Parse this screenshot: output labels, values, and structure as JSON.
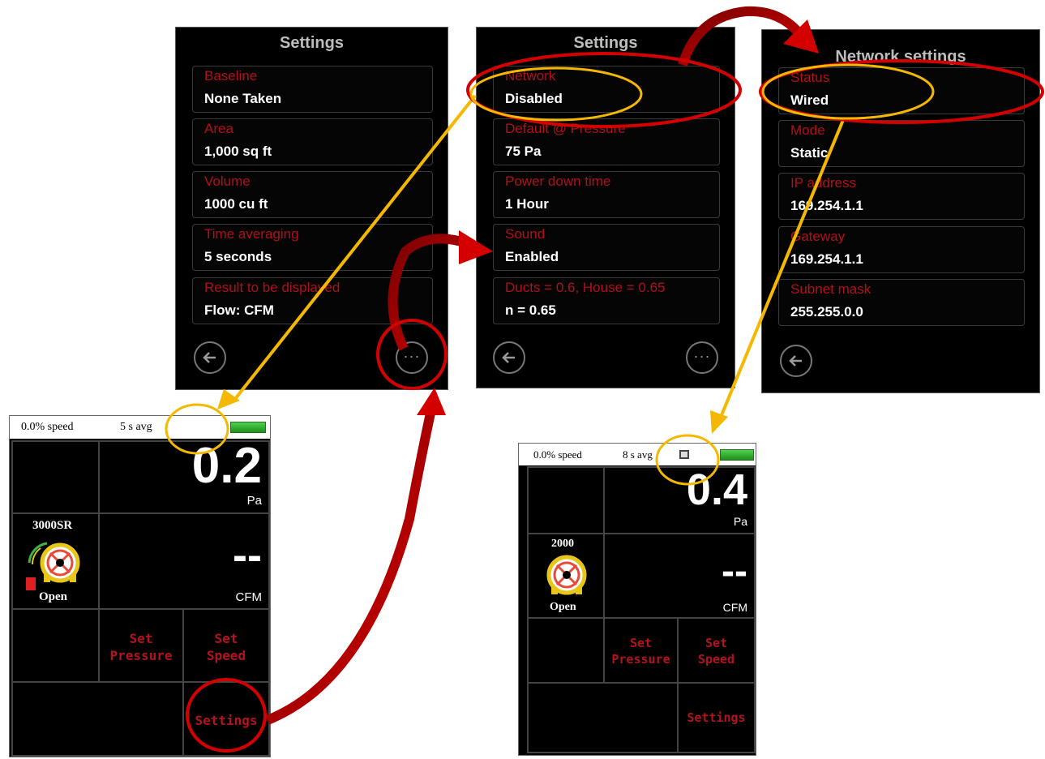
{
  "screen1": {
    "title": "Settings",
    "rows": [
      {
        "label": "Baseline",
        "value": "None Taken"
      },
      {
        "label": "Area",
        "value": "1,000 sq ft"
      },
      {
        "label": "Volume",
        "value": "1000 cu ft"
      },
      {
        "label": "Time averaging",
        "value": "5 seconds"
      },
      {
        "label": "Result to be displayed",
        "value": "Flow: CFM"
      }
    ],
    "back_icon": "left-arrow-icon",
    "more_icon": "more-dots-icon"
  },
  "screen2": {
    "title": "Settings",
    "rows": [
      {
        "label": "Network",
        "value": "Disabled"
      },
      {
        "label": "Default @ Pressure",
        "value": "75 Pa"
      },
      {
        "label": "Power down time",
        "value": "1 Hour"
      },
      {
        "label": "Sound",
        "value": "Enabled"
      },
      {
        "label": "Ducts = 0.6, House = 0.65",
        "value": "n = 0.65"
      }
    ],
    "back_icon": "left-arrow-icon",
    "more_icon": "more-dots-icon"
  },
  "screen3": {
    "title": "Network settings",
    "rows": [
      {
        "label": "Status",
        "value": "Wired"
      },
      {
        "label": "Mode",
        "value": "Static"
      },
      {
        "label": "IP address",
        "value": "169.254.1.1"
      },
      {
        "label": "Gateway",
        "value": "169.254.1.1"
      },
      {
        "label": "Subnet mask",
        "value": "255.255.0.0"
      }
    ],
    "back_icon": "left-arrow-icon"
  },
  "device1": {
    "speed": "0.0% speed",
    "avg": "5 s avg",
    "pressure_value": "0.2",
    "pressure_unit": "Pa",
    "fan_model": "3000SR",
    "fan_state": "Open",
    "flow_value": "--",
    "flow_unit": "CFM",
    "btn_set_pressure_1": "Set",
    "btn_set_pressure_2": "Pressure",
    "btn_set_speed_1": "Set",
    "btn_set_speed_2": "Speed",
    "btn_settings": "Settings"
  },
  "device2": {
    "speed": "0.0% speed",
    "avg": "8 s avg",
    "network_icon": "ethernet-icon",
    "pressure_value": "0.4",
    "pressure_unit": "Pa",
    "fan_model": "2000",
    "fan_state": "Open",
    "flow_value": "--",
    "flow_unit": "CFM",
    "btn_set_pressure_1": "Set",
    "btn_set_pressure_2": "Pressure",
    "btn_set_speed_1": "Set",
    "btn_set_speed_2": "Speed",
    "btn_settings": "Settings"
  },
  "colors": {
    "label_red": "#b30f1a",
    "highlight_red": "#d40000",
    "highlight_yellow": "#f5b800",
    "battery_green": "#2fb32f"
  }
}
